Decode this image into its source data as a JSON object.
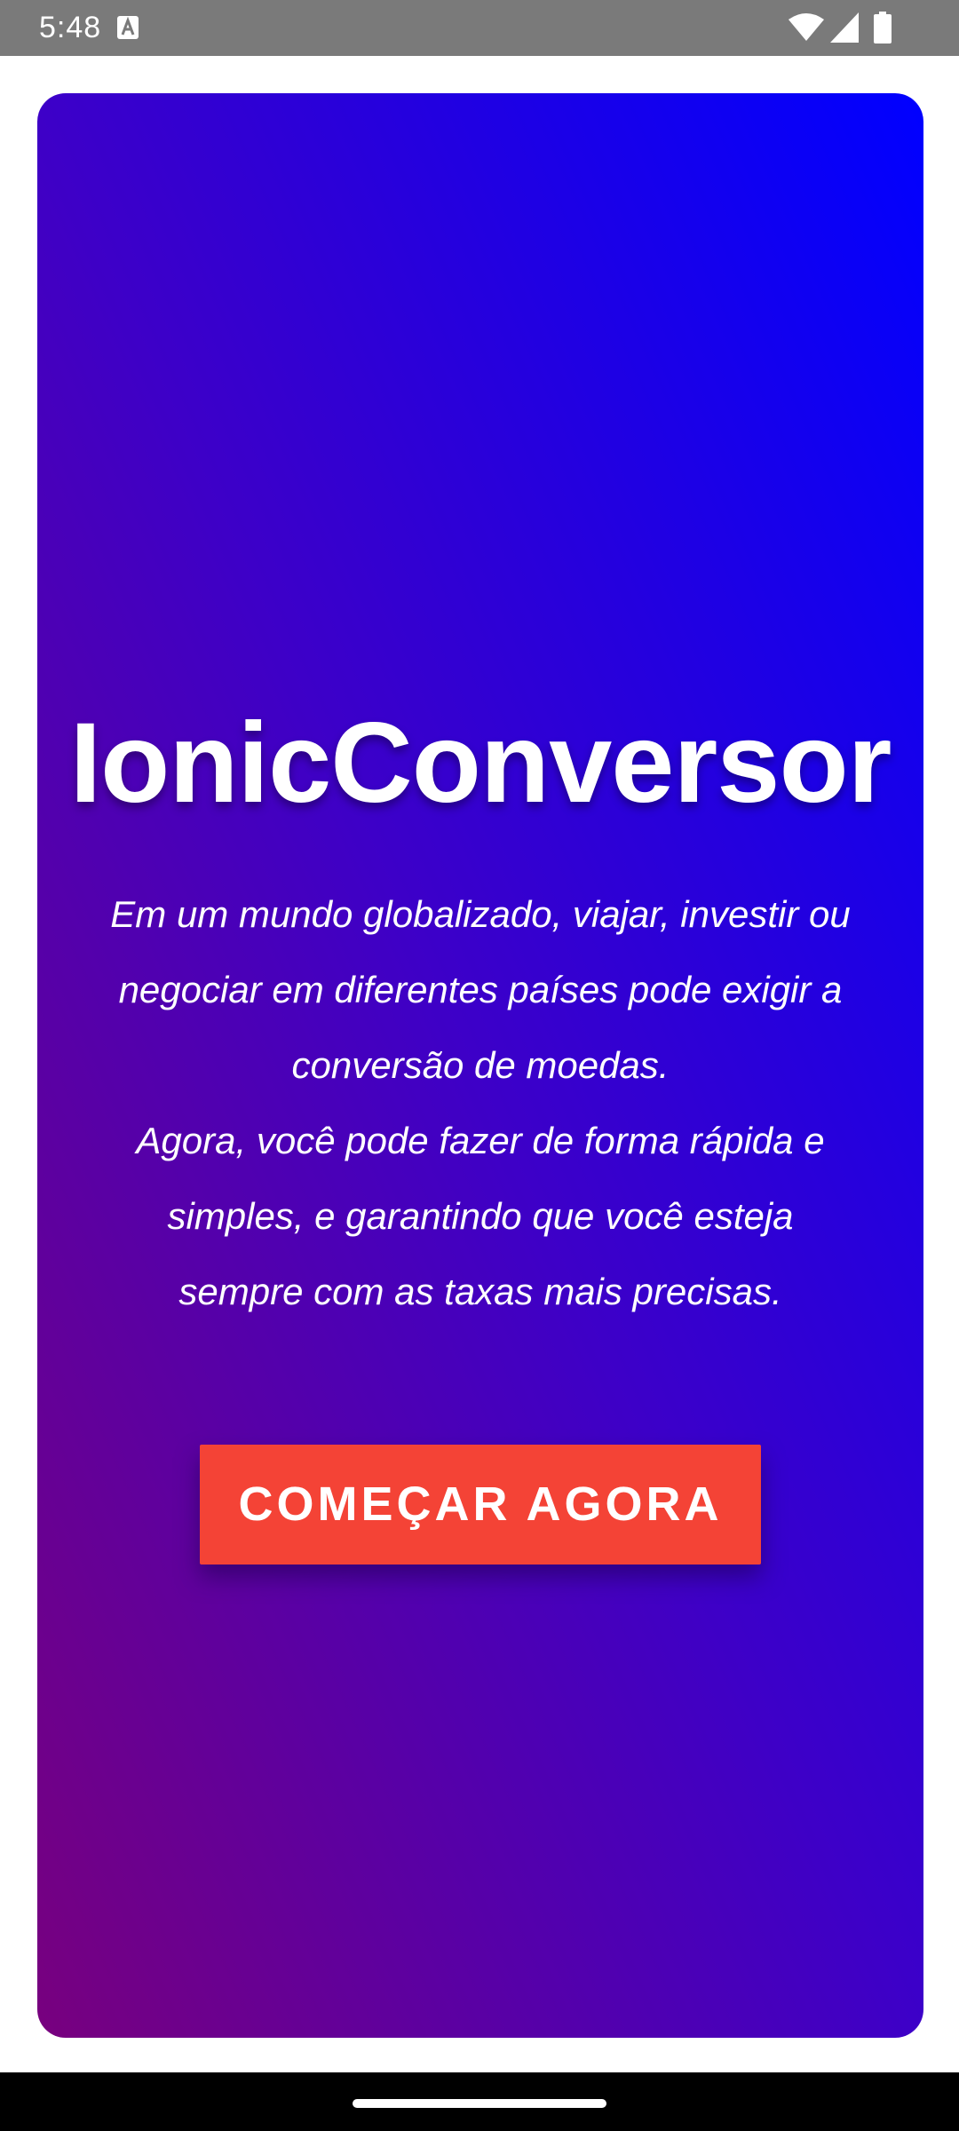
{
  "status_bar": {
    "time": "5:48",
    "notification_icon": "a-icon",
    "icons": [
      "wifi-icon",
      "signal-icon",
      "battery-icon"
    ]
  },
  "app": {
    "title": "IonicConversor",
    "description_paragraphs": [
      "Em um mundo globalizado, viajar, investir ou negociar em diferentes países pode exigir a conversão de moedas.",
      "Agora, você pode fazer de forma rápida e simples, e garantindo que você esteja sempre com as taxas mais precisas."
    ],
    "start_button_label": "COMEÇAR AGORA"
  },
  "colors": {
    "gradient_top_right": "#0000ff",
    "gradient_bottom_left": "#78007e",
    "button": "#f44336",
    "status_bar": "#7a7a7a"
  }
}
